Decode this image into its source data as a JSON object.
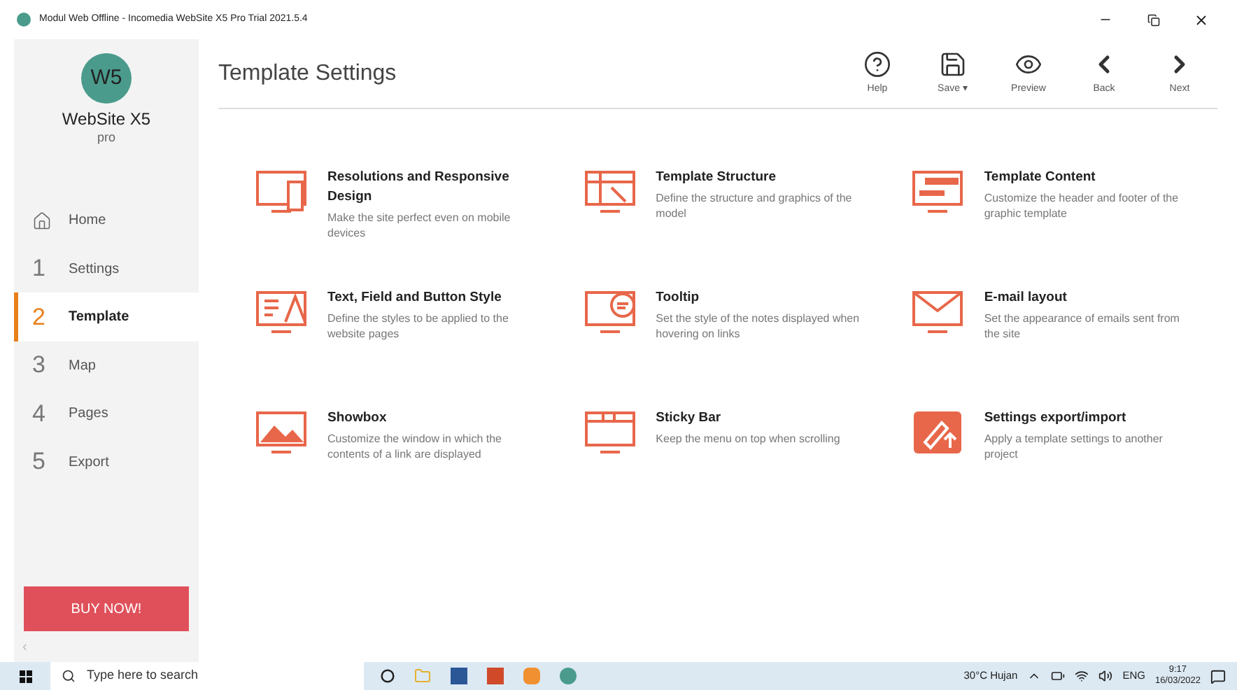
{
  "window": {
    "title": "Modul Web Offline - Incomedia WebSite X5 Pro Trial 2021.5.4"
  },
  "logo": {
    "mark": "W5",
    "name": "WebSite X5",
    "edition": "pro"
  },
  "page_title": "Template Settings",
  "toolbar": [
    {
      "label": "Help",
      "kind": "help"
    },
    {
      "label": "Save",
      "kind": "save",
      "caret": "▾"
    },
    {
      "label": "Preview",
      "kind": "preview"
    },
    {
      "label": "Back",
      "kind": "back"
    },
    {
      "label": "Next",
      "kind": "next"
    }
  ],
  "sidebar": {
    "items": [
      {
        "label": "Home",
        "selected": false
      },
      {
        "number": "1",
        "label": "Settings",
        "selected": false
      },
      {
        "number": "2",
        "label": "Template",
        "selected": true
      },
      {
        "number": "3",
        "label": "Map",
        "selected": false
      },
      {
        "number": "4",
        "label": "Pages",
        "selected": false
      },
      {
        "number": "5",
        "label": "Export",
        "selected": false
      }
    ],
    "buy_button": "BUY NOW!",
    "collapse": "‹"
  },
  "options": [
    {
      "title": "Resolutions and Responsive Design",
      "description": "Make the site perfect even on mobile devices"
    },
    {
      "title": "Template Structure",
      "description": "Define the structure and graphics of the model"
    },
    {
      "title": "Template Content",
      "description": "Customize the header and footer of the graphic template"
    },
    {
      "title": "Text, Field and Button Style",
      "description": "Define the styles to be applied to the website pages"
    },
    {
      "title": "Tooltip",
      "description": "Set the style of the notes displayed when hovering on links"
    },
    {
      "title": "E-mail layout",
      "description": "Set the appearance of emails sent from the site"
    },
    {
      "title": "Showbox",
      "description": "Customize the window in which the contents of a link are displayed"
    },
    {
      "title": "Sticky Bar",
      "description": "Keep the menu on top when scrolling"
    },
    {
      "title": "Settings export/import",
      "description": "Apply a template settings to another project"
    }
  ],
  "taskbar": {
    "search_placeholder": "Type here to search",
    "weather": "30°C Hujan",
    "language": "ENG",
    "time": "9:17",
    "date": "16/03/2022"
  }
}
